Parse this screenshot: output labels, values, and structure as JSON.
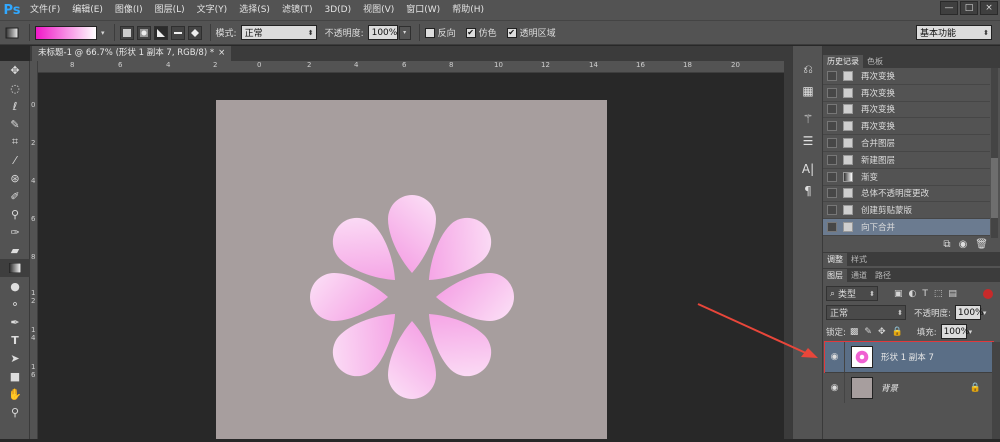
{
  "menubar": {
    "logo": "Ps",
    "items": [
      "文件(F)",
      "编辑(E)",
      "图像(I)",
      "图层(L)",
      "文字(Y)",
      "选择(S)",
      "滤镜(T)",
      "3D(D)",
      "视图(V)",
      "窗口(W)",
      "帮助(H)"
    ],
    "win_buttons": [
      "—",
      "□",
      "×"
    ]
  },
  "options": {
    "mode_label": "模式:",
    "mode_value": "正常",
    "opacity_label": "不透明度:",
    "opacity_value": "100%",
    "reverse_label": "反向",
    "dither_label": "仿色",
    "transparency_label": "透明区域",
    "workspace": "基本功能"
  },
  "document": {
    "tab_title": "未标题-1 @ 66.7% (形状 1 副本 7, RGB/8) *",
    "tab_close": "×",
    "canvas_color": "#a79e9e",
    "ruler_top": [
      "8",
      "6",
      "4",
      "2",
      "0",
      "2",
      "4",
      "6",
      "8",
      "10",
      "12",
      "14",
      "16",
      "18",
      "20"
    ],
    "ruler_left": [
      "0",
      "2",
      "4",
      "6",
      "8",
      "1",
      "2",
      "1",
      "4",
      "1",
      "6"
    ]
  },
  "tools": [
    "move-tool-icon",
    "marquee-icon",
    "lasso-icon",
    "quick-select-icon",
    "crop-icon",
    "eyedropper-icon",
    "healing-icon",
    "brush-icon",
    "stamp-icon",
    "history-brush-icon",
    "eraser-icon",
    "gradient-icon",
    "blur-icon",
    "dodge-icon",
    "pen-icon",
    "type-icon",
    "path-select-icon",
    "shape-icon",
    "hand-icon",
    "zoom-icon"
  ],
  "history": {
    "tabs": [
      "历史记录",
      "色板"
    ],
    "items": [
      "再次变换",
      "再次变换",
      "再次变换",
      "再次变换",
      "合并图层",
      "新建图层",
      "渐变",
      "总体不透明度更改",
      "创建剪贴蒙版",
      "向下合并"
    ],
    "selected_index": 9
  },
  "adjust_tabs": [
    "调整",
    "样式"
  ],
  "layers": {
    "tabs": [
      "图层",
      "通道",
      "路径"
    ],
    "filter_label": "类型",
    "blend_mode": "正常",
    "opacity_label": "不透明度:",
    "opacity_value": "100%",
    "lock_label": "锁定:",
    "fill_label": "填充:",
    "fill_value": "100%",
    "items": [
      {
        "name": "形状 1 副本 7",
        "selected": true
      },
      {
        "name": "背景",
        "selected": false
      }
    ]
  },
  "colors": {
    "accent_selected": "#5a6e86",
    "highlight_border": "#e0393d",
    "arrow": "#e8463a",
    "petal_light": "#ffffff",
    "petal_dark": "#e514bd"
  }
}
